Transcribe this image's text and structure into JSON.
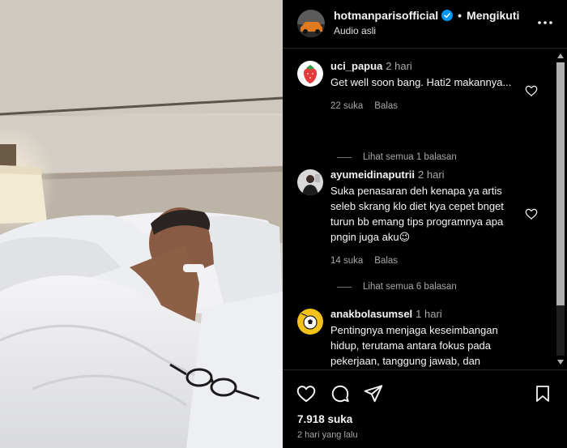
{
  "post": {
    "username": "hotmanparisofficial",
    "separator": "•",
    "follow_label": "Mengikuti",
    "audio": "Audio asli",
    "likes": "7.918 suka",
    "posted": "2 hari yang lalu"
  },
  "comments": [
    {
      "username": "uci_papua",
      "time": "2 hari",
      "text": "Get well soon bang. Hati2 makannya...",
      "likes": "22 suka",
      "reply_label": "Balas",
      "view_replies": "Lihat semua 1 balasan"
    },
    {
      "username": "ayumeidinaputrii",
      "time": "2 hari",
      "text": "Suka penasaran deh kenapa ya artis seleb skrang klo diet kya cepet bnget turun bb emang tips programnya apa pngin juga aku😉",
      "likes": "14 suka",
      "reply_label": "Balas",
      "view_replies": "Lihat semua 6 balasan"
    },
    {
      "username": "anakbolasumsel",
      "time": "1 hari",
      "text": "Pentingnya menjaga keseimbangan hidup, terutama antara fokus pada pekerjaan, tanggung jawab, dan"
    }
  ],
  "colors": {
    "background": "#000000",
    "text": "#f5f5f5",
    "muted": "#a8a8a8",
    "verified": "#0095f6"
  },
  "icons": [
    "more-icon",
    "heart-icon",
    "comment-icon",
    "share-icon",
    "bookmark-icon",
    "verified-badge-icon"
  ]
}
